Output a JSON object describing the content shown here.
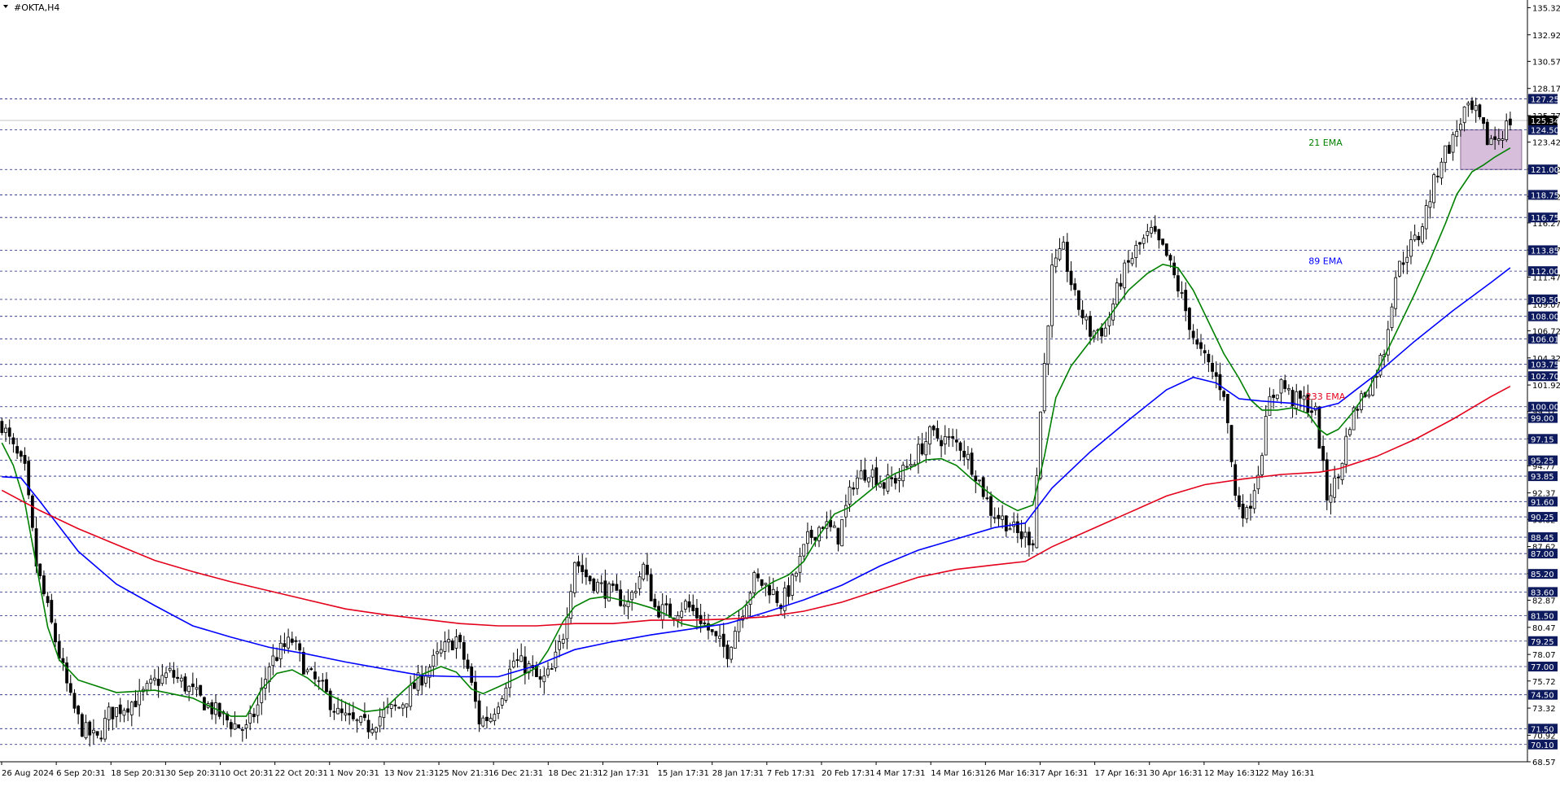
{
  "window": {
    "symbol": "#OKTA,H4"
  },
  "colors": {
    "background": "#ffffff",
    "candle": "#000000",
    "grid": "#1a237e",
    "ema21": "#008000",
    "ema89": "#0000ff",
    "ema233": "#e3001b",
    "price_box": "#0d1b5e",
    "zone": "#c9a9cf"
  },
  "chart_data": {
    "type": "candlestick",
    "title": "#OKTA,H4",
    "price_range": [
      68.57,
      136.0
    ],
    "y_ticks": [
      135.32,
      132.92,
      130.57,
      128.17,
      125.77,
      123.42,
      121.02,
      118.62,
      116.27,
      113.87,
      111.47,
      109.07,
      106.72,
      104.32,
      101.92,
      99.57,
      97.17,
      94.77,
      92.37,
      90.02,
      87.62,
      85.22,
      82.87,
      80.47,
      78.07,
      75.72,
      73.32,
      70.92,
      68.57
    ],
    "horizontal_levels": [
      127.25,
      124.5,
      121.0,
      118.75,
      116.75,
      113.85,
      112.0,
      109.5,
      108.0,
      106.01,
      103.75,
      102.7,
      100.0,
      99.0,
      97.15,
      95.25,
      93.85,
      91.6,
      90.25,
      88.45,
      87.0,
      85.2,
      83.6,
      81.5,
      79.25,
      77.0,
      74.5,
      71.5,
      70.1
    ],
    "current_price": 125.34,
    "x_labels": [
      "26 Aug 2024",
      "6 Sep 20:31",
      "18 Sep 20:31",
      "30 Sep 20:31",
      "10 Oct 20:31",
      "22 Oct 20:31",
      "1 Nov 20:31",
      "13 Nov 21:31",
      "25 Nov 21:31",
      "6 Dec 21:31",
      "18 Dec 21:31",
      "2 Jan 17:31",
      "15 Jan 17:31",
      "28 Jan 17:31",
      "7 Feb 17:31",
      "20 Feb 17:31",
      "4 Mar 17:31",
      "14 Mar 16:31",
      "26 Mar 16:31",
      "7 Apr 16:31",
      "17 Apr 16:31",
      "30 Apr 16:31",
      "12 May 16:31",
      "22 May 16:31"
    ],
    "zone": {
      "from": 121.0,
      "to": 124.5
    },
    "price_path": [
      [
        0,
        98.5
      ],
      [
        3,
        96.2
      ],
      [
        6,
        94.3
      ],
      [
        9,
        86.0
      ],
      [
        12,
        82.0
      ],
      [
        15,
        78.0
      ],
      [
        18,
        74.0
      ],
      [
        21,
        71.5
      ],
      [
        25,
        70.5
      ],
      [
        28,
        72.8
      ],
      [
        32,
        73.5
      ],
      [
        36,
        74.2
      ],
      [
        40,
        75.6
      ],
      [
        44,
        76.4
      ],
      [
        48,
        75.3
      ],
      [
        52,
        74.1
      ],
      [
        56,
        73.0
      ],
      [
        60,
        72.0
      ],
      [
        64,
        71.4
      ],
      [
        67,
        73.5
      ],
      [
        70,
        77.2
      ],
      [
        73,
        78.4
      ],
      [
        76,
        79.3
      ],
      [
        80,
        76.4
      ],
      [
        84,
        75.0
      ],
      [
        88,
        72.8
      ],
      [
        92,
        72.0
      ],
      [
        96,
        71.7
      ],
      [
        100,
        72.9
      ],
      [
        104,
        73.4
      ],
      [
        108,
        75.2
      ],
      [
        112,
        77.0
      ],
      [
        116,
        78.6
      ],
      [
        119,
        79.5
      ],
      [
        122,
        76.8
      ],
      [
        125,
        72.2
      ],
      [
        128,
        72.6
      ],
      [
        131,
        74.8
      ],
      [
        134,
        77.5
      ],
      [
        138,
        76.9
      ],
      [
        141,
        75.5
      ],
      [
        144,
        76.6
      ],
      [
        147,
        79.9
      ],
      [
        150,
        86.5
      ],
      [
        153,
        85.0
      ],
      [
        156,
        84.2
      ],
      [
        160,
        83.4
      ],
      [
        164,
        82.6
      ],
      [
        168,
        85.8
      ],
      [
        171,
        82.2
      ],
      [
        175,
        81.7
      ],
      [
        179,
        82.5
      ],
      [
        183,
        81.2
      ],
      [
        187,
        79.3
      ],
      [
        190,
        78.4
      ],
      [
        193,
        81.3
      ],
      [
        197,
        84.7
      ],
      [
        201,
        84.0
      ],
      [
        204,
        82.6
      ],
      [
        207,
        84.4
      ],
      [
        211,
        88.2
      ],
      [
        215,
        89.7
      ],
      [
        219,
        88.5
      ],
      [
        223,
        93.4
      ],
      [
        227,
        94.5
      ],
      [
        231,
        93.1
      ],
      [
        235,
        93.8
      ],
      [
        239,
        95.5
      ],
      [
        243,
        97.5
      ],
      [
        247,
        97.1
      ],
      [
        251,
        96.6
      ],
      [
        255,
        94.2
      ],
      [
        259,
        90.8
      ],
      [
        263,
        89.8
      ],
      [
        266,
        88.7
      ],
      [
        270,
        88.3
      ],
      [
        272,
        99.6
      ],
      [
        275,
        112.0
      ],
      [
        278,
        113.8
      ],
      [
        281,
        109.6
      ],
      [
        285,
        106.6
      ],
      [
        289,
        106.9
      ],
      [
        293,
        111.3
      ],
      [
        297,
        113.9
      ],
      [
        301,
        115.4
      ],
      [
        305,
        113.3
      ],
      [
        309,
        109.6
      ],
      [
        313,
        105.2
      ],
      [
        317,
        103.1
      ],
      [
        320,
        101.4
      ],
      [
        323,
        92.0
      ],
      [
        326,
        90.4
      ],
      [
        329,
        94.4
      ],
      [
        332,
        100.5
      ],
      [
        335,
        102.2
      ],
      [
        338,
        100.6
      ],
      [
        341,
        100.5
      ],
      [
        344,
        99.4
      ],
      [
        347,
        92.0
      ],
      [
        350,
        93.8
      ],
      [
        353,
        98.7
      ],
      [
        356,
        100.8
      ],
      [
        359,
        102.3
      ],
      [
        362,
        105.1
      ],
      [
        365,
        111.7
      ],
      [
        368,
        113.8
      ],
      [
        371,
        115.1
      ],
      [
        374,
        118.6
      ],
      [
        377,
        122.1
      ],
      [
        380,
        123.6
      ],
      [
        383,
        126.2
      ],
      [
        386,
        125.9
      ],
      [
        389,
        123.6
      ],
      [
        392,
        123.9
      ],
      [
        395,
        125.3
      ]
    ],
    "series": [
      {
        "name": "21 EMA",
        "color": "#008000",
        "points": [
          [
            0,
            96.8
          ],
          [
            3,
            94.8
          ],
          [
            6,
            91.5
          ],
          [
            9,
            86.0
          ],
          [
            12,
            80.5
          ],
          [
            15,
            77.6
          ],
          [
            20,
            75.8
          ],
          [
            30,
            74.7
          ],
          [
            40,
            74.9
          ],
          [
            50,
            74.2
          ],
          [
            60,
            72.6
          ],
          [
            64,
            72.6
          ],
          [
            68,
            75.0
          ],
          [
            72,
            76.4
          ],
          [
            76,
            76.7
          ],
          [
            80,
            76.0
          ],
          [
            85,
            74.6
          ],
          [
            90,
            73.8
          ],
          [
            95,
            73.0
          ],
          [
            100,
            73.2
          ],
          [
            105,
            74.8
          ],
          [
            110,
            76.3
          ],
          [
            115,
            77.0
          ],
          [
            119,
            76.5
          ],
          [
            123,
            75.0
          ],
          [
            126,
            74.6
          ],
          [
            130,
            75.2
          ],
          [
            135,
            76.0
          ],
          [
            140,
            76.9
          ],
          [
            143,
            78.4
          ],
          [
            147,
            81.0
          ],
          [
            150,
            82.3
          ],
          [
            154,
            83.0
          ],
          [
            158,
            83.2
          ],
          [
            162,
            82.9
          ],
          [
            166,
            82.6
          ],
          [
            170,
            82.2
          ],
          [
            174,
            81.6
          ],
          [
            178,
            80.8
          ],
          [
            182,
            80.5
          ],
          [
            186,
            80.7
          ],
          [
            190,
            81.3
          ],
          [
            194,
            82.2
          ],
          [
            198,
            83.6
          ],
          [
            202,
            84.5
          ],
          [
            206,
            85.1
          ],
          [
            210,
            86.3
          ],
          [
            214,
            88.6
          ],
          [
            218,
            90.5
          ],
          [
            222,
            91.1
          ],
          [
            226,
            92.2
          ],
          [
            230,
            93.3
          ],
          [
            234,
            94.1
          ],
          [
            238,
            94.6
          ],
          [
            242,
            95.3
          ],
          [
            246,
            95.4
          ],
          [
            250,
            94.8
          ],
          [
            254,
            93.6
          ],
          [
            258,
            92.5
          ],
          [
            262,
            91.5
          ],
          [
            266,
            90.8
          ],
          [
            270,
            91.3
          ],
          [
            273,
            95.6
          ],
          [
            276,
            100.8
          ],
          [
            280,
            103.6
          ],
          [
            285,
            105.8
          ],
          [
            290,
            108.0
          ],
          [
            295,
            110.3
          ],
          [
            300,
            111.8
          ],
          [
            304,
            112.6
          ],
          [
            308,
            112.3
          ],
          [
            312,
            110.3
          ],
          [
            316,
            107.5
          ],
          [
            320,
            104.7
          ],
          [
            324,
            102.5
          ],
          [
            327,
            100.6
          ],
          [
            330,
            99.7
          ],
          [
            334,
            99.7
          ],
          [
            338,
            99.9
          ],
          [
            342,
            99.4
          ],
          [
            345,
            98.0
          ],
          [
            347,
            97.5
          ],
          [
            350,
            98.0
          ],
          [
            354,
            99.6
          ],
          [
            358,
            101.6
          ],
          [
            362,
            104.4
          ],
          [
            366,
            107.2
          ],
          [
            370,
            110.0
          ],
          [
            374,
            113.0
          ],
          [
            378,
            116.2
          ],
          [
            381,
            118.8
          ],
          [
            385,
            120.8
          ],
          [
            388,
            121.4
          ],
          [
            391,
            122.1
          ],
          [
            395,
            122.9
          ]
        ]
      },
      {
        "name": "89 EMA",
        "color": "#0000ff",
        "points": [
          [
            0,
            93.8
          ],
          [
            5,
            93.7
          ],
          [
            10,
            91.6
          ],
          [
            20,
            87.2
          ],
          [
            30,
            84.3
          ],
          [
            40,
            82.4
          ],
          [
            50,
            80.6
          ],
          [
            60,
            79.6
          ],
          [
            70,
            78.7
          ],
          [
            80,
            78.1
          ],
          [
            90,
            77.4
          ],
          [
            100,
            76.8
          ],
          [
            110,
            76.2
          ],
          [
            120,
            76.1
          ],
          [
            130,
            76.1
          ],
          [
            140,
            77.1
          ],
          [
            150,
            78.5
          ],
          [
            160,
            79.2
          ],
          [
            170,
            79.8
          ],
          [
            180,
            80.3
          ],
          [
            190,
            80.8
          ],
          [
            200,
            81.8
          ],
          [
            210,
            82.9
          ],
          [
            220,
            84.2
          ],
          [
            230,
            85.9
          ],
          [
            240,
            87.3
          ],
          [
            250,
            88.3
          ],
          [
            260,
            89.3
          ],
          [
            268,
            89.7
          ],
          [
            275,
            92.8
          ],
          [
            285,
            96.0
          ],
          [
            295,
            98.8
          ],
          [
            305,
            101.5
          ],
          [
            312,
            102.6
          ],
          [
            318,
            102.1
          ],
          [
            324,
            100.7
          ],
          [
            330,
            100.5
          ],
          [
            338,
            100.3
          ],
          [
            344,
            99.8
          ],
          [
            350,
            100.3
          ],
          [
            360,
            102.9
          ],
          [
            370,
            105.8
          ],
          [
            380,
            108.5
          ],
          [
            390,
            111.0
          ],
          [
            395,
            112.3
          ]
        ]
      },
      {
        "name": "233 EMA",
        "color": "#e3001b",
        "points": [
          [
            0,
            92.6
          ],
          [
            10,
            90.8
          ],
          [
            20,
            89.2
          ],
          [
            30,
            87.8
          ],
          [
            40,
            86.4
          ],
          [
            50,
            85.4
          ],
          [
            60,
            84.5
          ],
          [
            70,
            83.7
          ],
          [
            80,
            82.9
          ],
          [
            90,
            82.1
          ],
          [
            100,
            81.6
          ],
          [
            110,
            81.2
          ],
          [
            120,
            80.8
          ],
          [
            130,
            80.6
          ],
          [
            140,
            80.6
          ],
          [
            150,
            80.8
          ],
          [
            160,
            80.8
          ],
          [
            170,
            81.1
          ],
          [
            180,
            81.1
          ],
          [
            190,
            81.2
          ],
          [
            200,
            81.4
          ],
          [
            210,
            81.9
          ],
          [
            220,
            82.7
          ],
          [
            230,
            83.8
          ],
          [
            240,
            84.9
          ],
          [
            250,
            85.6
          ],
          [
            260,
            86.0
          ],
          [
            268,
            86.3
          ],
          [
            275,
            87.6
          ],
          [
            285,
            89.1
          ],
          [
            295,
            90.6
          ],
          [
            305,
            92.1
          ],
          [
            315,
            93.1
          ],
          [
            325,
            93.6
          ],
          [
            335,
            94.0
          ],
          [
            345,
            94.2
          ],
          [
            350,
            94.5
          ],
          [
            360,
            95.6
          ],
          [
            370,
            97.1
          ],
          [
            380,
            98.9
          ],
          [
            390,
            100.9
          ],
          [
            395,
            101.8
          ]
        ]
      }
    ],
    "annotations": [
      {
        "text": "21 EMA",
        "price": 123.4,
        "color": "#008000"
      },
      {
        "text": "89 EMA",
        "price": 112.9,
        "color": "#0000ff"
      },
      {
        "text": "233 EMA",
        "price": 100.9,
        "color": "#e3001b"
      }
    ]
  }
}
